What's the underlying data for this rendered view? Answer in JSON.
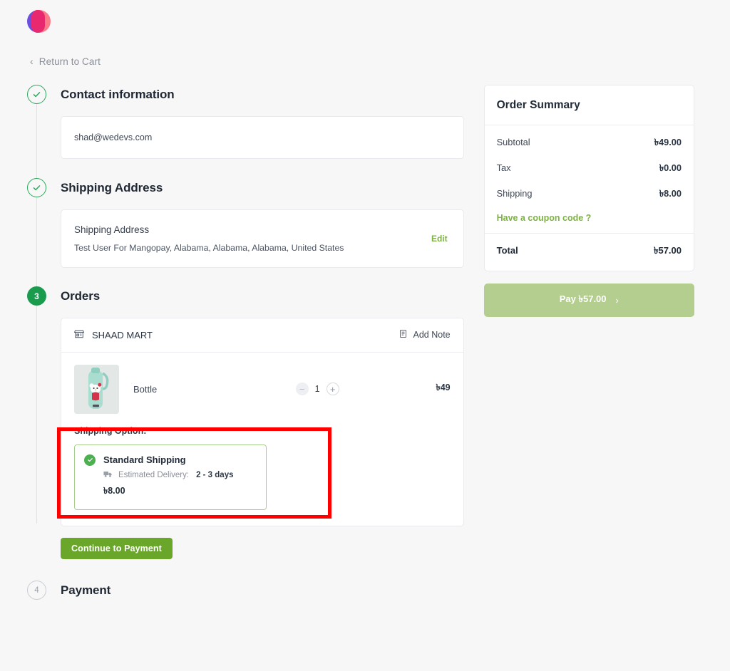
{
  "header": {
    "logo_icon": "dokan-logo",
    "return_link": "Return to Cart",
    "return_icon": "chevron-left-icon"
  },
  "steps": {
    "contact": {
      "number": "1",
      "state": "done",
      "title": "Contact information",
      "email": "shad@wedevs.com"
    },
    "shipping": {
      "number": "2",
      "state": "done",
      "title": "Shipping Address",
      "card_label": "Shipping Address",
      "address": "Test User For Mangopay, Alabama, Alabama, Alabama, United States",
      "edit_label": "Edit"
    },
    "orders": {
      "number": "3",
      "state": "active",
      "title": "Orders",
      "store_name": "SHAAD MART",
      "store_icon": "storefront-icon",
      "add_note_label": "Add Note",
      "add_note_icon": "note-icon",
      "product": {
        "name": "Bottle",
        "image_icon": "bottle-thumbnail",
        "quantity": "1",
        "minus_icon": "minus-icon",
        "plus_icon": "plus-icon",
        "price": "৳49"
      },
      "shipping_option": {
        "label": "Shipping Option:",
        "selected_icon": "check-circle-icon",
        "name": "Standard Shipping",
        "delivery_icon": "truck-icon",
        "delivery_label": "Estimated Delivery:",
        "delivery_days": "2 - 3 days",
        "price": "৳8.00"
      },
      "continue_label": "Continue to Payment"
    },
    "payment": {
      "number": "4",
      "state": "pending",
      "title": "Payment"
    }
  },
  "summary": {
    "title": "Order Summary",
    "rows": [
      {
        "label": "Subtotal",
        "value": "৳49.00"
      },
      {
        "label": "Tax",
        "value": "৳0.00"
      },
      {
        "label": "Shipping",
        "value": "৳8.00"
      }
    ],
    "coupon_label": "Have a coupon code ?",
    "total_label": "Total",
    "total_value": "৳57.00",
    "pay_label": "Pay ৳57.00",
    "pay_arrow": "›"
  },
  "colors": {
    "brand_green": "#7cb342",
    "button_green": "#6aa62a",
    "pay_disabled_green": "#b3ce8e",
    "step_active": "#1a9b4d",
    "step_done": "#2aa95a",
    "annotation_red": "#ff0000",
    "page_bg": "#f7f7f8"
  }
}
